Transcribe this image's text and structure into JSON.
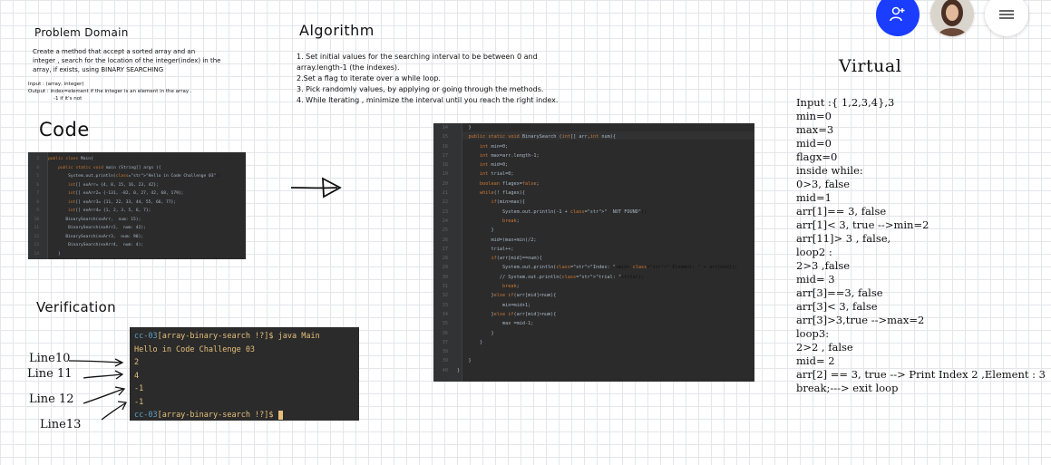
{
  "toolbar": {
    "share_icon": "add-user-icon",
    "menu_icon": "hamburger-menu-icon",
    "accent_color": "#1a3dff"
  },
  "problem": {
    "title": "Problem Domain",
    "desc": [
      "Create a method that accept a sorted array and an",
      "integer , search for the location of the integer(index) in the",
      "array, if exists, using BINARY SEARCHING"
    ],
    "input": "Input : (array, integer)",
    "output": "Output : index=element if the integer is an element in the array .",
    "output2": "-1 if it's not"
  },
  "code_title": "Code",
  "code_lines": [
    {
      "n": "3",
      "t": "public class Main{"
    },
    {
      "n": "4",
      "t": "    public static void main (String[] args ){"
    },
    {
      "n": "5",
      "t": "        System.out.println(\"Hello in Code Challenge 03\");"
    },
    {
      "n": "6",
      "t": "        int[] exArr= {4, 8, 15, 16, 23, 42};"
    },
    {
      "n": "7",
      "t": "        int[] exArr2= {-131, -82, 0, 27, 42, 68, 179};"
    },
    {
      "n": "8",
      "t": "        int[] exArr3= {11, 22, 33, 44, 55, 66, 77};"
    },
    {
      "n": "9",
      "t": "        int[] exArr4= {1, 2, 3, 5, 6, 7};"
    },
    {
      "n": "10",
      "t": "       BinarySearch(exArr,  num: 15);"
    },
    {
      "n": "11",
      "t": "        BinarySearch(exArr2,  num: 42);"
    },
    {
      "n": "12",
      "t": "       BinarySearch(exArr3,  num: 90);"
    },
    {
      "n": "13",
      "t": "        BinarySearch(exArr4,  num: 4);"
    },
    {
      "n": "14",
      "t": "    }"
    }
  ],
  "algorithm": {
    "title": "Algorithm",
    "steps": [
      "1. Set initial values for the searching interval to be between 0 and",
      "array.length-1  (the indexes).",
      "2.Set a flag to iterate over a while loop.",
      "3. Pick randomly values, by applying or going through the methods.",
      "4. While Iterating , minimize the interval until you reach the right index."
    ]
  },
  "algo_code_lines": [
    {
      "n": "14",
      "t": "    }"
    },
    {
      "n": "15",
      "t": "    public static void BinarySearch (int[] arr,int num){"
    },
    {
      "n": "16",
      "t": "        int min=0;"
    },
    {
      "n": "17",
      "t": "        int max=arr.length-1;"
    },
    {
      "n": "18",
      "t": "        int mid=0;"
    },
    {
      "n": "19",
      "t": "        int trial=0;"
    },
    {
      "n": "20",
      "t": "        boolean flagex=false;"
    },
    {
      "n": "21",
      "t": "        while(! flagex){"
    },
    {
      "n": "22",
      "t": "            if(min>max){"
    },
    {
      "n": "23",
      "t": "                System.out.println(-1 + \"  NOT FOUND\");"
    },
    {
      "n": "24",
      "t": "                break;"
    },
    {
      "n": "25",
      "t": "            }"
    },
    {
      "n": "26",
      "t": "            mid=(max+min)/2;"
    },
    {
      "n": "27",
      "t": "            trial++;"
    },
    {
      "n": "28",
      "t": "            if(arr[mid]==num){"
    },
    {
      "n": "29",
      "t": "                System.out.println(\"Index: \"+mid+ \" Element: \" + arr[mid]);"
    },
    {
      "n": "30",
      "t": "               // System.out.println(\"trial: \"+trial);"
    },
    {
      "n": "31",
      "t": "                break;"
    },
    {
      "n": "32",
      "t": "            }else if(arr[mid]<num){"
    },
    {
      "n": "33",
      "t": "                min=mid+1;"
    },
    {
      "n": "34",
      "t": "            }else if(arr[mid]>num){"
    },
    {
      "n": "35",
      "t": "                max =mid-1;"
    },
    {
      "n": "36",
      "t": "            }"
    },
    {
      "n": "37",
      "t": "        }"
    },
    {
      "n": "38",
      "t": ""
    },
    {
      "n": "39",
      "t": "    }"
    },
    {
      "n": "40",
      "t": "}"
    }
  ],
  "verification": {
    "title": "Verification",
    "terminal": [
      {
        "kind": "prompt",
        "text": "cc-03[array-binary-search !?]$ java Main"
      },
      {
        "kind": "out",
        "text": "Hello in Code Challenge 03"
      },
      {
        "kind": "out",
        "text": "2"
      },
      {
        "kind": "out",
        "text": "4"
      },
      {
        "kind": "out",
        "text": "-1"
      },
      {
        "kind": "out",
        "text": "-1"
      },
      {
        "kind": "prompt_end",
        "text": "cc-03[array-binary-search !?]$ "
      }
    ],
    "labels": [
      "Line10",
      "Line 11",
      "Line 12",
      "Line13"
    ]
  },
  "virtual": {
    "title": "Virtual",
    "lines": [
      "Input :{ 1,2,3,4},3",
      "min=0",
      "max=3",
      "mid=0",
      "flagx=0",
      "inside while:",
      "0>3, false",
      "mid=1",
      "arr[1]== 3, false",
      "arr[1]< 3, true -->min=2",
      "arr[11]> 3 , false,",
      "loop2 :",
      "2>3 ,false",
      "mid= 3",
      "arr[3]==3, false",
      "arr[3]< 3, false",
      "arr[3]>3,true -->max=2",
      "loop3:",
      "2>2 , false",
      "mid= 2",
      "arr[2] == 3, true --> Print Index 2 ,Element : 3",
      "break;---> exit loop"
    ]
  }
}
